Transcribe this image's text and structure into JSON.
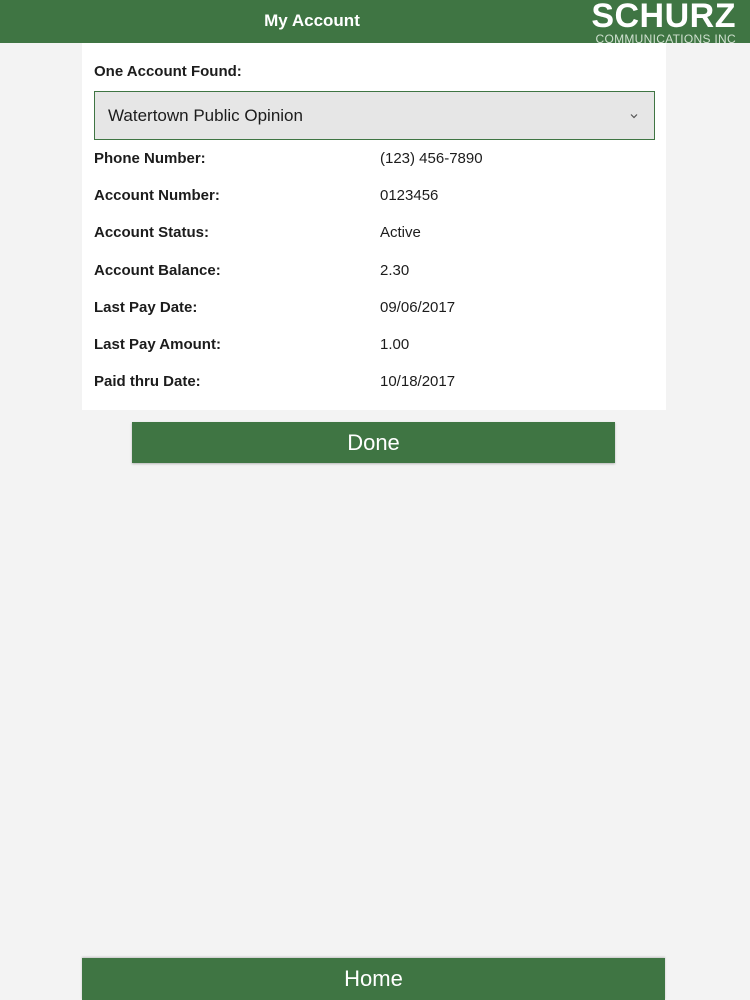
{
  "header": {
    "title": "My Account",
    "logo_main": "SCHURZ",
    "logo_sub": "COMMUNICATIONS INC"
  },
  "account": {
    "found_label": "One Account Found:",
    "selected": "Watertown Public Opinion",
    "fields": [
      {
        "label": "Phone Number:",
        "value": "(123) 456-7890"
      },
      {
        "label": "Account Number:",
        "value": "0123456"
      },
      {
        "label": "Account Status:",
        "value": "Active"
      },
      {
        "label": "Account Balance:",
        "value": "2.30"
      },
      {
        "label": "Last Pay Date:",
        "value": "09/06/2017"
      },
      {
        "label": "Last Pay Amount:",
        "value": "1.00"
      },
      {
        "label": "Paid thru Date:",
        "value": "10/18/2017"
      }
    ]
  },
  "buttons": {
    "done_label": "Done",
    "home_label": "Home"
  },
  "colors": {
    "brand_green": "#3f7543",
    "background": "#f3f3f3",
    "panel": "#ffffff"
  },
  "icons": {
    "dropdown": "chevron-down-icon"
  }
}
